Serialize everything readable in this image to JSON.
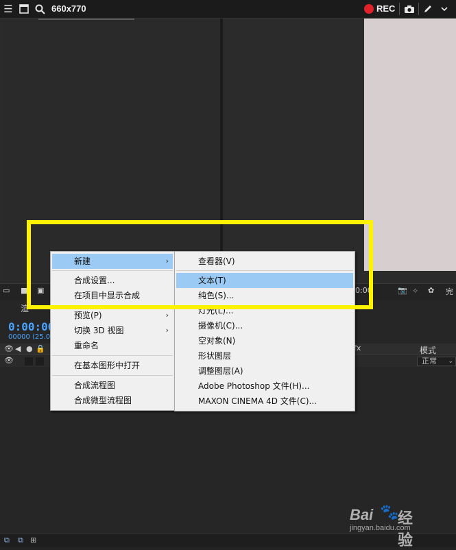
{
  "topbar": {
    "title": "660x770",
    "rec_label": "REC"
  },
  "viewer_toolbar": {
    "time_fragment": "0:00",
    "right_fragment": "完"
  },
  "timeline": {
    "tab_fragment": "渲",
    "timecode": "0:00:00",
    "frames": "00000 (25.00",
    "mode_label": "模式",
    "mode_value": "正常",
    "fx_icons": "fx"
  },
  "menu_main": {
    "items": [
      {
        "label": "新建",
        "submenu": true,
        "highlighted": true
      },
      {
        "label": "合成设置..."
      },
      {
        "label": "在项目中显示合成"
      },
      {
        "label": "预览(P)",
        "submenu": true
      },
      {
        "label": "切换 3D 视图",
        "submenu": true
      },
      {
        "label": "重命名"
      },
      {
        "label": "在基本图形中打开"
      },
      {
        "label": "合成流程图"
      },
      {
        "label": "合成微型流程图"
      }
    ]
  },
  "menu_new": {
    "items": [
      {
        "label": "查看器(V)"
      },
      {
        "label": "文本(T)",
        "highlighted": true
      },
      {
        "label": "纯色(S)..."
      },
      {
        "label": "灯光(L)..."
      },
      {
        "label": "摄像机(C)..."
      },
      {
        "label": "空对象(N)"
      },
      {
        "label": "形状图层"
      },
      {
        "label": "调整图层(A)"
      },
      {
        "label": "Adobe Photoshop 文件(H)..."
      },
      {
        "label": "MAXON CINEMA 4D 文件(C)..."
      }
    ]
  },
  "watermark": {
    "brand": "Bai",
    "brand2": "经验",
    "url": "jingyan.baidu.com"
  },
  "colors": {
    "highlight_box": "#fff200",
    "menu_highlight": "#9bcbf4",
    "timecode": "#4aa3ff",
    "rec": "#e2222a"
  }
}
